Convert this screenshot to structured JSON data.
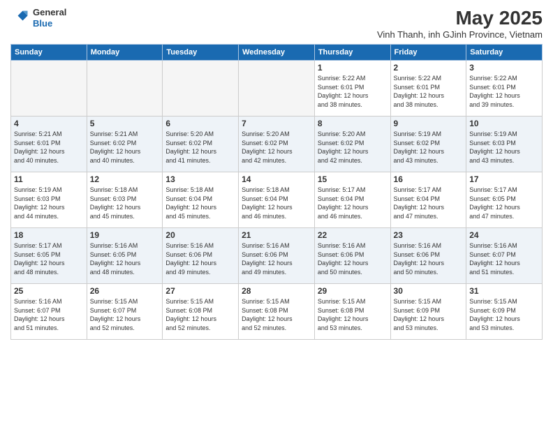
{
  "logo": {
    "line1": "General",
    "line2": "Blue"
  },
  "title": "May 2025",
  "subtitle": "Vinh Thanh, inh GJinh Province, Vietnam",
  "weekdays": [
    "Sunday",
    "Monday",
    "Tuesday",
    "Wednesday",
    "Thursday",
    "Friday",
    "Saturday"
  ],
  "weeks": [
    [
      {
        "day": "",
        "info": ""
      },
      {
        "day": "",
        "info": ""
      },
      {
        "day": "",
        "info": ""
      },
      {
        "day": "",
        "info": ""
      },
      {
        "day": "1",
        "info": "Sunrise: 5:22 AM\nSunset: 6:01 PM\nDaylight: 12 hours\nand 38 minutes."
      },
      {
        "day": "2",
        "info": "Sunrise: 5:22 AM\nSunset: 6:01 PM\nDaylight: 12 hours\nand 38 minutes."
      },
      {
        "day": "3",
        "info": "Sunrise: 5:22 AM\nSunset: 6:01 PM\nDaylight: 12 hours\nand 39 minutes."
      }
    ],
    [
      {
        "day": "4",
        "info": "Sunrise: 5:21 AM\nSunset: 6:01 PM\nDaylight: 12 hours\nand 40 minutes."
      },
      {
        "day": "5",
        "info": "Sunrise: 5:21 AM\nSunset: 6:02 PM\nDaylight: 12 hours\nand 40 minutes."
      },
      {
        "day": "6",
        "info": "Sunrise: 5:20 AM\nSunset: 6:02 PM\nDaylight: 12 hours\nand 41 minutes."
      },
      {
        "day": "7",
        "info": "Sunrise: 5:20 AM\nSunset: 6:02 PM\nDaylight: 12 hours\nand 42 minutes."
      },
      {
        "day": "8",
        "info": "Sunrise: 5:20 AM\nSunset: 6:02 PM\nDaylight: 12 hours\nand 42 minutes."
      },
      {
        "day": "9",
        "info": "Sunrise: 5:19 AM\nSunset: 6:02 PM\nDaylight: 12 hours\nand 43 minutes."
      },
      {
        "day": "10",
        "info": "Sunrise: 5:19 AM\nSunset: 6:03 PM\nDaylight: 12 hours\nand 43 minutes."
      }
    ],
    [
      {
        "day": "11",
        "info": "Sunrise: 5:19 AM\nSunset: 6:03 PM\nDaylight: 12 hours\nand 44 minutes."
      },
      {
        "day": "12",
        "info": "Sunrise: 5:18 AM\nSunset: 6:03 PM\nDaylight: 12 hours\nand 45 minutes."
      },
      {
        "day": "13",
        "info": "Sunrise: 5:18 AM\nSunset: 6:04 PM\nDaylight: 12 hours\nand 45 minutes."
      },
      {
        "day": "14",
        "info": "Sunrise: 5:18 AM\nSunset: 6:04 PM\nDaylight: 12 hours\nand 46 minutes."
      },
      {
        "day": "15",
        "info": "Sunrise: 5:17 AM\nSunset: 6:04 PM\nDaylight: 12 hours\nand 46 minutes."
      },
      {
        "day": "16",
        "info": "Sunrise: 5:17 AM\nSunset: 6:04 PM\nDaylight: 12 hours\nand 47 minutes."
      },
      {
        "day": "17",
        "info": "Sunrise: 5:17 AM\nSunset: 6:05 PM\nDaylight: 12 hours\nand 47 minutes."
      }
    ],
    [
      {
        "day": "18",
        "info": "Sunrise: 5:17 AM\nSunset: 6:05 PM\nDaylight: 12 hours\nand 48 minutes."
      },
      {
        "day": "19",
        "info": "Sunrise: 5:16 AM\nSunset: 6:05 PM\nDaylight: 12 hours\nand 48 minutes."
      },
      {
        "day": "20",
        "info": "Sunrise: 5:16 AM\nSunset: 6:06 PM\nDaylight: 12 hours\nand 49 minutes."
      },
      {
        "day": "21",
        "info": "Sunrise: 5:16 AM\nSunset: 6:06 PM\nDaylight: 12 hours\nand 49 minutes."
      },
      {
        "day": "22",
        "info": "Sunrise: 5:16 AM\nSunset: 6:06 PM\nDaylight: 12 hours\nand 50 minutes."
      },
      {
        "day": "23",
        "info": "Sunrise: 5:16 AM\nSunset: 6:06 PM\nDaylight: 12 hours\nand 50 minutes."
      },
      {
        "day": "24",
        "info": "Sunrise: 5:16 AM\nSunset: 6:07 PM\nDaylight: 12 hours\nand 51 minutes."
      }
    ],
    [
      {
        "day": "25",
        "info": "Sunrise: 5:16 AM\nSunset: 6:07 PM\nDaylight: 12 hours\nand 51 minutes."
      },
      {
        "day": "26",
        "info": "Sunrise: 5:15 AM\nSunset: 6:07 PM\nDaylight: 12 hours\nand 52 minutes."
      },
      {
        "day": "27",
        "info": "Sunrise: 5:15 AM\nSunset: 6:08 PM\nDaylight: 12 hours\nand 52 minutes."
      },
      {
        "day": "28",
        "info": "Sunrise: 5:15 AM\nSunset: 6:08 PM\nDaylight: 12 hours\nand 52 minutes."
      },
      {
        "day": "29",
        "info": "Sunrise: 5:15 AM\nSunset: 6:08 PM\nDaylight: 12 hours\nand 53 minutes."
      },
      {
        "day": "30",
        "info": "Sunrise: 5:15 AM\nSunset: 6:09 PM\nDaylight: 12 hours\nand 53 minutes."
      },
      {
        "day": "31",
        "info": "Sunrise: 5:15 AM\nSunset: 6:09 PM\nDaylight: 12 hours\nand 53 minutes."
      }
    ]
  ]
}
